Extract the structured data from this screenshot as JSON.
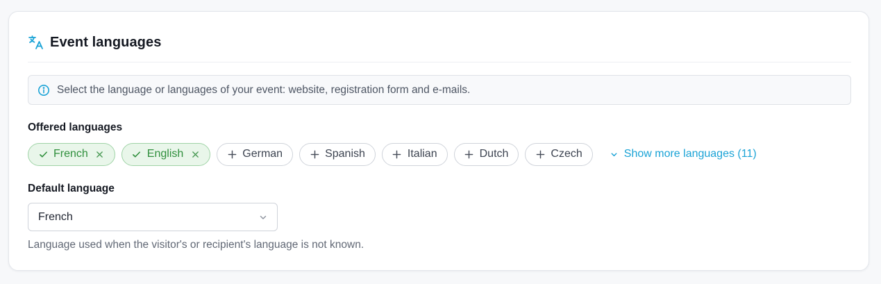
{
  "section": {
    "title": "Event languages",
    "icon": "translate-icon",
    "info_text": "Select the language or languages of your event: website, registration form and e-mails."
  },
  "offered": {
    "label": "Offered languages",
    "selected": [
      {
        "label": "French"
      },
      {
        "label": "English"
      }
    ],
    "available": [
      {
        "label": "German"
      },
      {
        "label": "Spanish"
      },
      {
        "label": "Italian"
      },
      {
        "label": "Dutch"
      },
      {
        "label": "Czech"
      }
    ],
    "show_more_label": "Show more languages (11)"
  },
  "default_language": {
    "label": "Default language",
    "value": "French",
    "help": "Language used when the visitor's or recipient's language is not known."
  },
  "colors": {
    "accent": "#1aa3d6",
    "selected_bg": "#e9f6ea",
    "selected_text": "#2f8f3c",
    "selected_border": "#9fd3a6"
  }
}
